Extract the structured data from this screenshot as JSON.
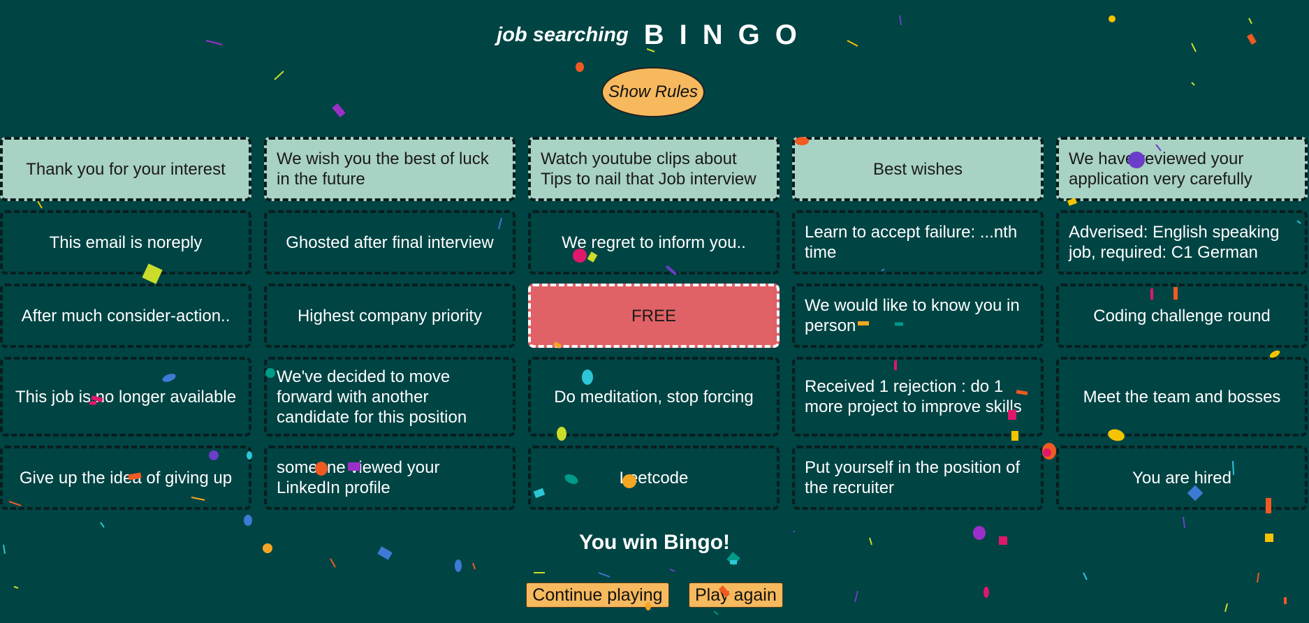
{
  "header": {
    "subtitle": "job searching",
    "title": "BINGO"
  },
  "rules_button": "Show Rules",
  "board": [
    [
      {
        "text": "Thank you for your interest",
        "marked": true
      },
      {
        "text": "We wish you the best of luck in the future",
        "marked": true
      },
      {
        "text": "Watch youtube clips about Tips to nail that Job interview",
        "marked": true
      },
      {
        "text": "Best wishes",
        "marked": true
      },
      {
        "text": "We have reviewed your application very carefully",
        "marked": true
      }
    ],
    [
      {
        "text": "This email is noreply",
        "marked": false
      },
      {
        "text": "Ghosted after final interview",
        "marked": false
      },
      {
        "text": "We regret to inform you..",
        "marked": false
      },
      {
        "text": "Learn to accept failure: ...nth time",
        "marked": false
      },
      {
        "text": "Adverised: English speaking job, required: C1 German",
        "marked": false
      }
    ],
    [
      {
        "text": "After much consider-action..",
        "marked": false
      },
      {
        "text": "Highest company priority",
        "marked": false
      },
      {
        "text": "FREE",
        "marked": true,
        "free": true
      },
      {
        "text": "We would like to know you in person",
        "marked": false
      },
      {
        "text": "Coding challenge round",
        "marked": false
      }
    ],
    [
      {
        "text": "This job is no longer available",
        "marked": false
      },
      {
        "text": "We've decided to move forward with another candidate for this position",
        "marked": false
      },
      {
        "text": "Do meditation, stop forcing",
        "marked": false
      },
      {
        "text": "Received 1 rejection : do 1 more project to improve skills",
        "marked": false
      },
      {
        "text": "Meet the team and bosses",
        "marked": false
      }
    ],
    [
      {
        "text": "Give up the idea of giving up",
        "marked": false
      },
      {
        "text": "someone viewed your LinkedIn profile",
        "marked": false
      },
      {
        "text": "Leetcode",
        "marked": false
      },
      {
        "text": "Put yourself in the position of the recruiter",
        "marked": false
      },
      {
        "text": "You are hired",
        "marked": false
      }
    ]
  ],
  "win_message": "You win Bingo!",
  "buttons": {
    "continue": "Continue playing",
    "play_again": "Play again"
  },
  "colors": {
    "background": "#004444",
    "marked_cell": "#a8d2c4",
    "free_cell": "#e06266",
    "button": "#f6b95e"
  }
}
